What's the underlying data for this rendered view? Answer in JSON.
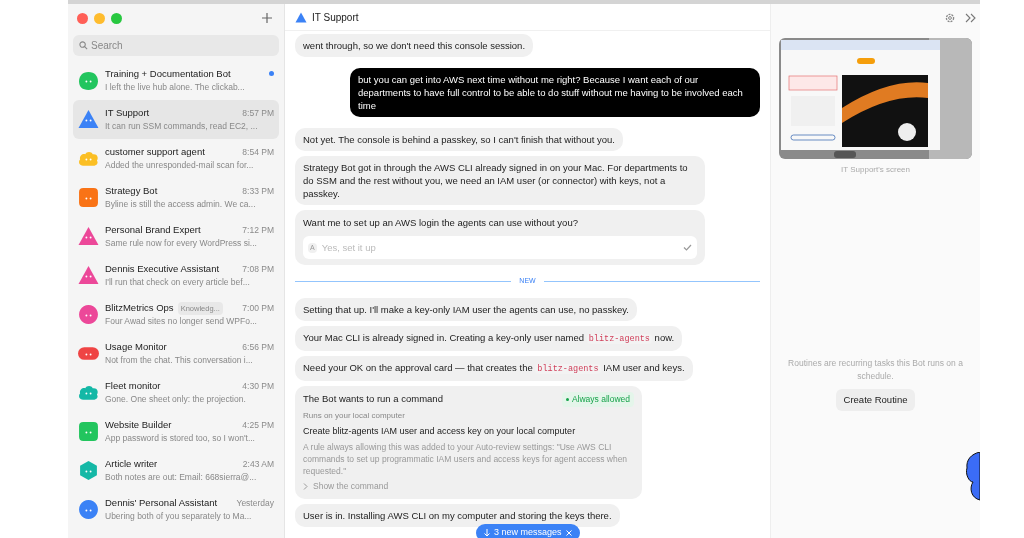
{
  "sidebar": {
    "search": {
      "placeholder": "Search"
    },
    "chats": [
      {
        "name": "Training + Documentation Bot",
        "preview": "I left the live hub alone. The clickab...",
        "unread": true,
        "selected": false,
        "avatar": {
          "kind": "blob",
          "color": "#22c55e"
        }
      },
      {
        "name": "IT Support",
        "preview": "It can run SSM commands, read EC2, ...",
        "time": "8:57 PM",
        "unread": false,
        "selected": true,
        "avatar": {
          "kind": "triangle",
          "color": "#3b82f6"
        }
      },
      {
        "name": "customer support agent",
        "preview": "Added the unresponded-mail scan for...",
        "time": "8:54 PM",
        "unread": false,
        "selected": false,
        "avatar": {
          "kind": "cloud",
          "color": "#fbbf24"
        }
      },
      {
        "name": "Strategy Bot",
        "preview": "Byline is still the access admin. We ca...",
        "time": "8:33 PM",
        "unread": false,
        "selected": false,
        "avatar": {
          "kind": "square",
          "color": "#f97316"
        }
      },
      {
        "name": "Personal Brand Expert",
        "preview": "Same rule now for every WordPress si...",
        "time": "7:12 PM",
        "unread": false,
        "selected": false,
        "avatar": {
          "kind": "triangle",
          "color": "#ec4899"
        }
      },
      {
        "name": "Dennis Executive Assistant",
        "preview": "I'll run that check on every article bef...",
        "time": "7:08 PM",
        "unread": false,
        "selected": false,
        "avatar": {
          "kind": "triangle",
          "color": "#ec4899"
        }
      },
      {
        "name": "BlitzMetrics Ops",
        "tag": "Knowledg...",
        "preview": "Four Awad sites no longer send WPFo...",
        "time": "7:00 PM",
        "unread": false,
        "selected": false,
        "avatar": {
          "kind": "circle",
          "color": "#ec4899"
        }
      },
      {
        "name": "Usage Monitor",
        "preview": "Not from the chat. This conversation i...",
        "time": "6:56 PM",
        "unread": false,
        "selected": false,
        "avatar": {
          "kind": "pill",
          "color": "#ef4444"
        }
      },
      {
        "name": "Fleet monitor",
        "preview": "Gone. One sheet only: the projection.",
        "time": "4:30 PM",
        "unread": false,
        "selected": false,
        "avatar": {
          "kind": "cloud",
          "color": "#14b8a6"
        }
      },
      {
        "name": "Website Builder",
        "preview": "App password is stored too, so I won't...",
        "time": "4:25 PM",
        "unread": false,
        "selected": false,
        "avatar": {
          "kind": "square",
          "color": "#22c55e"
        }
      },
      {
        "name": "Article writer",
        "preview": "Both notes are out: Email: 668sierra@...",
        "time": "2:43 AM",
        "unread": false,
        "selected": false,
        "avatar": {
          "kind": "hexagon",
          "color": "#14b8a6"
        }
      },
      {
        "name": "Dennis' Personal Assistant",
        "preview": "Ubering both of you separately to Ma...",
        "time": "Yesterday",
        "unread": false,
        "selected": false,
        "avatar": {
          "kind": "circle",
          "color": "#3b82f6"
        }
      }
    ]
  },
  "chat": {
    "title": "IT Support",
    "messages": [
      {
        "kind": "bot",
        "parts": [
          {
            "text": "went through, so we don't need this console session."
          }
        ]
      },
      {
        "kind": "user",
        "parts": [
          {
            "text": "but you can get into AWS next time without me right? Because I want each of our departments to have full control to be able to do stuff without me having to be involved each time"
          }
        ]
      },
      {
        "kind": "bot",
        "parts": [
          {
            "text": "Not yet. The console is behind a passkey, so I can't finish that without you."
          }
        ]
      },
      {
        "kind": "bot",
        "parts": [
          {
            "text": "Strategy Bot got in through the AWS CLI already signed in on your Mac. For departments to do SSM and the rest without you, we need an IAM user (or connector) with keys, not a passkey."
          }
        ]
      },
      {
        "kind": "question",
        "question": "Want me to set up an AWS login the agents can use without you?",
        "option_key": "A",
        "option": "Yes, set it up",
        "checked": true
      },
      {
        "kind": "divider",
        "label": "NEW"
      },
      {
        "kind": "bot",
        "parts": [
          {
            "text": "Setting that up. I'll make a key-only IAM user the agents can use, no passkey."
          }
        ]
      },
      {
        "kind": "bot",
        "parts": [
          {
            "text": "Your Mac CLI is already signed in. Creating a key-only user named "
          },
          {
            "code": "blitz-agents"
          },
          {
            "text": " now."
          }
        ]
      },
      {
        "kind": "bot",
        "parts": [
          {
            "text": "Need your OK on the approval card — that creates the "
          },
          {
            "code": "blitz-agents"
          },
          {
            "text": " IAM user and keys."
          }
        ]
      },
      {
        "kind": "approval",
        "title": "The Bot wants to run a command",
        "status": "Always allowed",
        "where": "Runs on your local computer",
        "action": "Create blitz-agents IAM user and access key on your local computer",
        "note": "A rule always allowing this was added to your Auto-review settings: \"Use AWS CLI commands to set up programmatic IAM users and access keys for agent access when requested.\"",
        "toggle": "Show the command",
        "expanded": false
      },
      {
        "kind": "bot",
        "parts": [
          {
            "text": "User is in. Installing AWS CLI on my computer and storing the keys there."
          }
        ]
      }
    ],
    "new_messages": "3 new messages"
  },
  "panel": {
    "screen_caption": "IT Support's screen",
    "routines_text": "Routines are recurring tasks this Bot runs on a schedule.",
    "create_button": "Create Routine"
  }
}
